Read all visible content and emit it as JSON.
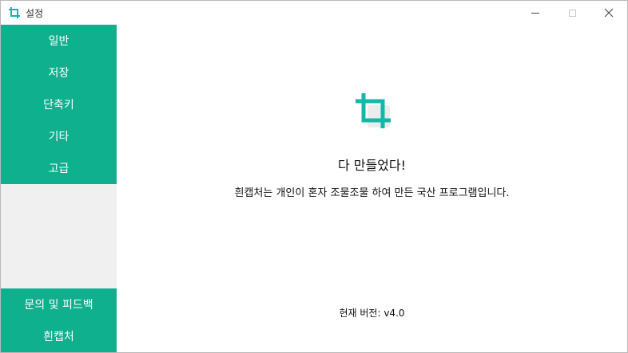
{
  "window": {
    "title": "설정",
    "icon": "crop-icon",
    "controls": [
      "minimize",
      "maximize",
      "close"
    ]
  },
  "sidebar": {
    "items": [
      {
        "label": "일반"
      },
      {
        "label": "저장"
      },
      {
        "label": "단축키"
      },
      {
        "label": "기타"
      },
      {
        "label": "고급"
      }
    ],
    "bottom_items": [
      {
        "label": "문의 및 피드백"
      },
      {
        "label": "흰캡처"
      }
    ]
  },
  "main": {
    "logo_icon": "crop-icon",
    "headline": "다 만들었다!",
    "description": "흰캡처는 개인이 혼자 조물조물 하여 만든 국산 프로그램입니다.",
    "version": "현재 버전: v4.0"
  },
  "colors": {
    "accent": "#0fb08e",
    "logo": "#10b9a8",
    "sidebar_bg": "#f0f0f0"
  }
}
